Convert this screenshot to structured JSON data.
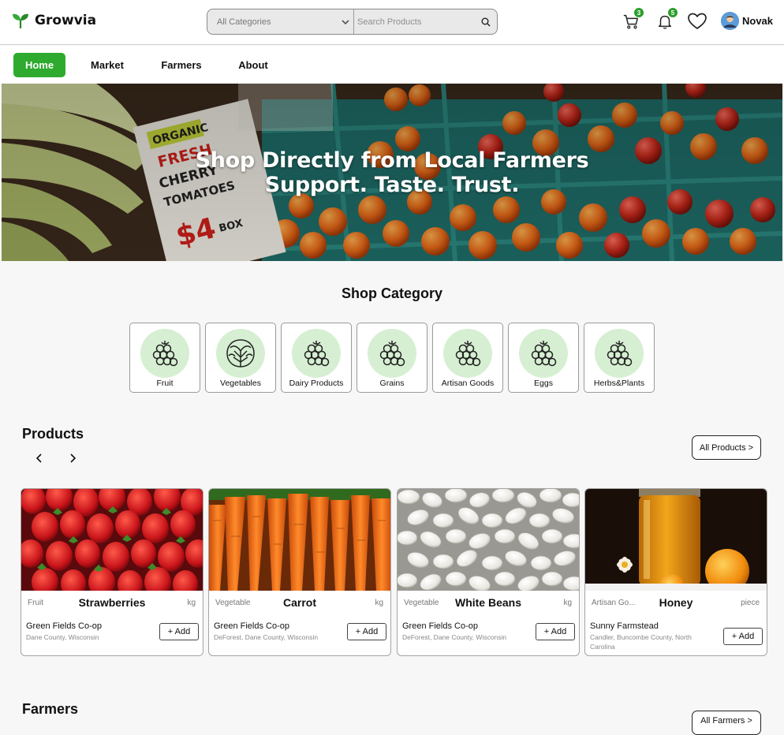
{
  "brand": {
    "name": "Growvia"
  },
  "search": {
    "category_selected": "All Categories",
    "placeholder": "Search Products"
  },
  "header": {
    "cart_count": "3",
    "notification_count": "5",
    "user_name": "Novak"
  },
  "nav": {
    "items": [
      "Home",
      "Market",
      "Farmers",
      "About"
    ],
    "active": "Home"
  },
  "hero": {
    "line1": "Shop Directly from Local Farmers",
    "line2": "Support. Taste. Trust."
  },
  "categories": {
    "title": "Shop Category",
    "items": [
      "Fruit",
      "Vegetables",
      "Dairy Products",
      "Grains",
      "Artisan Goods",
      "Eggs",
      "Herbs&Plants"
    ]
  },
  "products": {
    "title": "Products",
    "all_label": "All Products >",
    "add_label": "+ Add",
    "items": [
      {
        "category": "Fruit",
        "name": "Strawberries",
        "unit": "kg",
        "farm": "Green Fields Co-op",
        "location": "Dane County, Wisconsin"
      },
      {
        "category": "Vegetable",
        "name": "Carrot",
        "unit": "kg",
        "farm": "Green Fields Co-op",
        "location": "DeForest, Dane County, Wisconsin"
      },
      {
        "category": "Vegetable",
        "name": "White Beans",
        "unit": "kg",
        "farm": "Green Fields Co-op",
        "location": "DeForest, Dane County, Wisconsin"
      },
      {
        "category": "Artisan Go...",
        "name": "Honey",
        "unit": "piece",
        "farm": "Sunny Farmstead",
        "location": "Candler, Buncombe County, North Carolina"
      }
    ]
  },
  "farmers": {
    "title": "Farmers",
    "all_label": "All Farmers >"
  },
  "colors": {
    "accent": "#2eaa2e",
    "badge": "#2c9f2c",
    "category_circle": "#d6efd2"
  }
}
